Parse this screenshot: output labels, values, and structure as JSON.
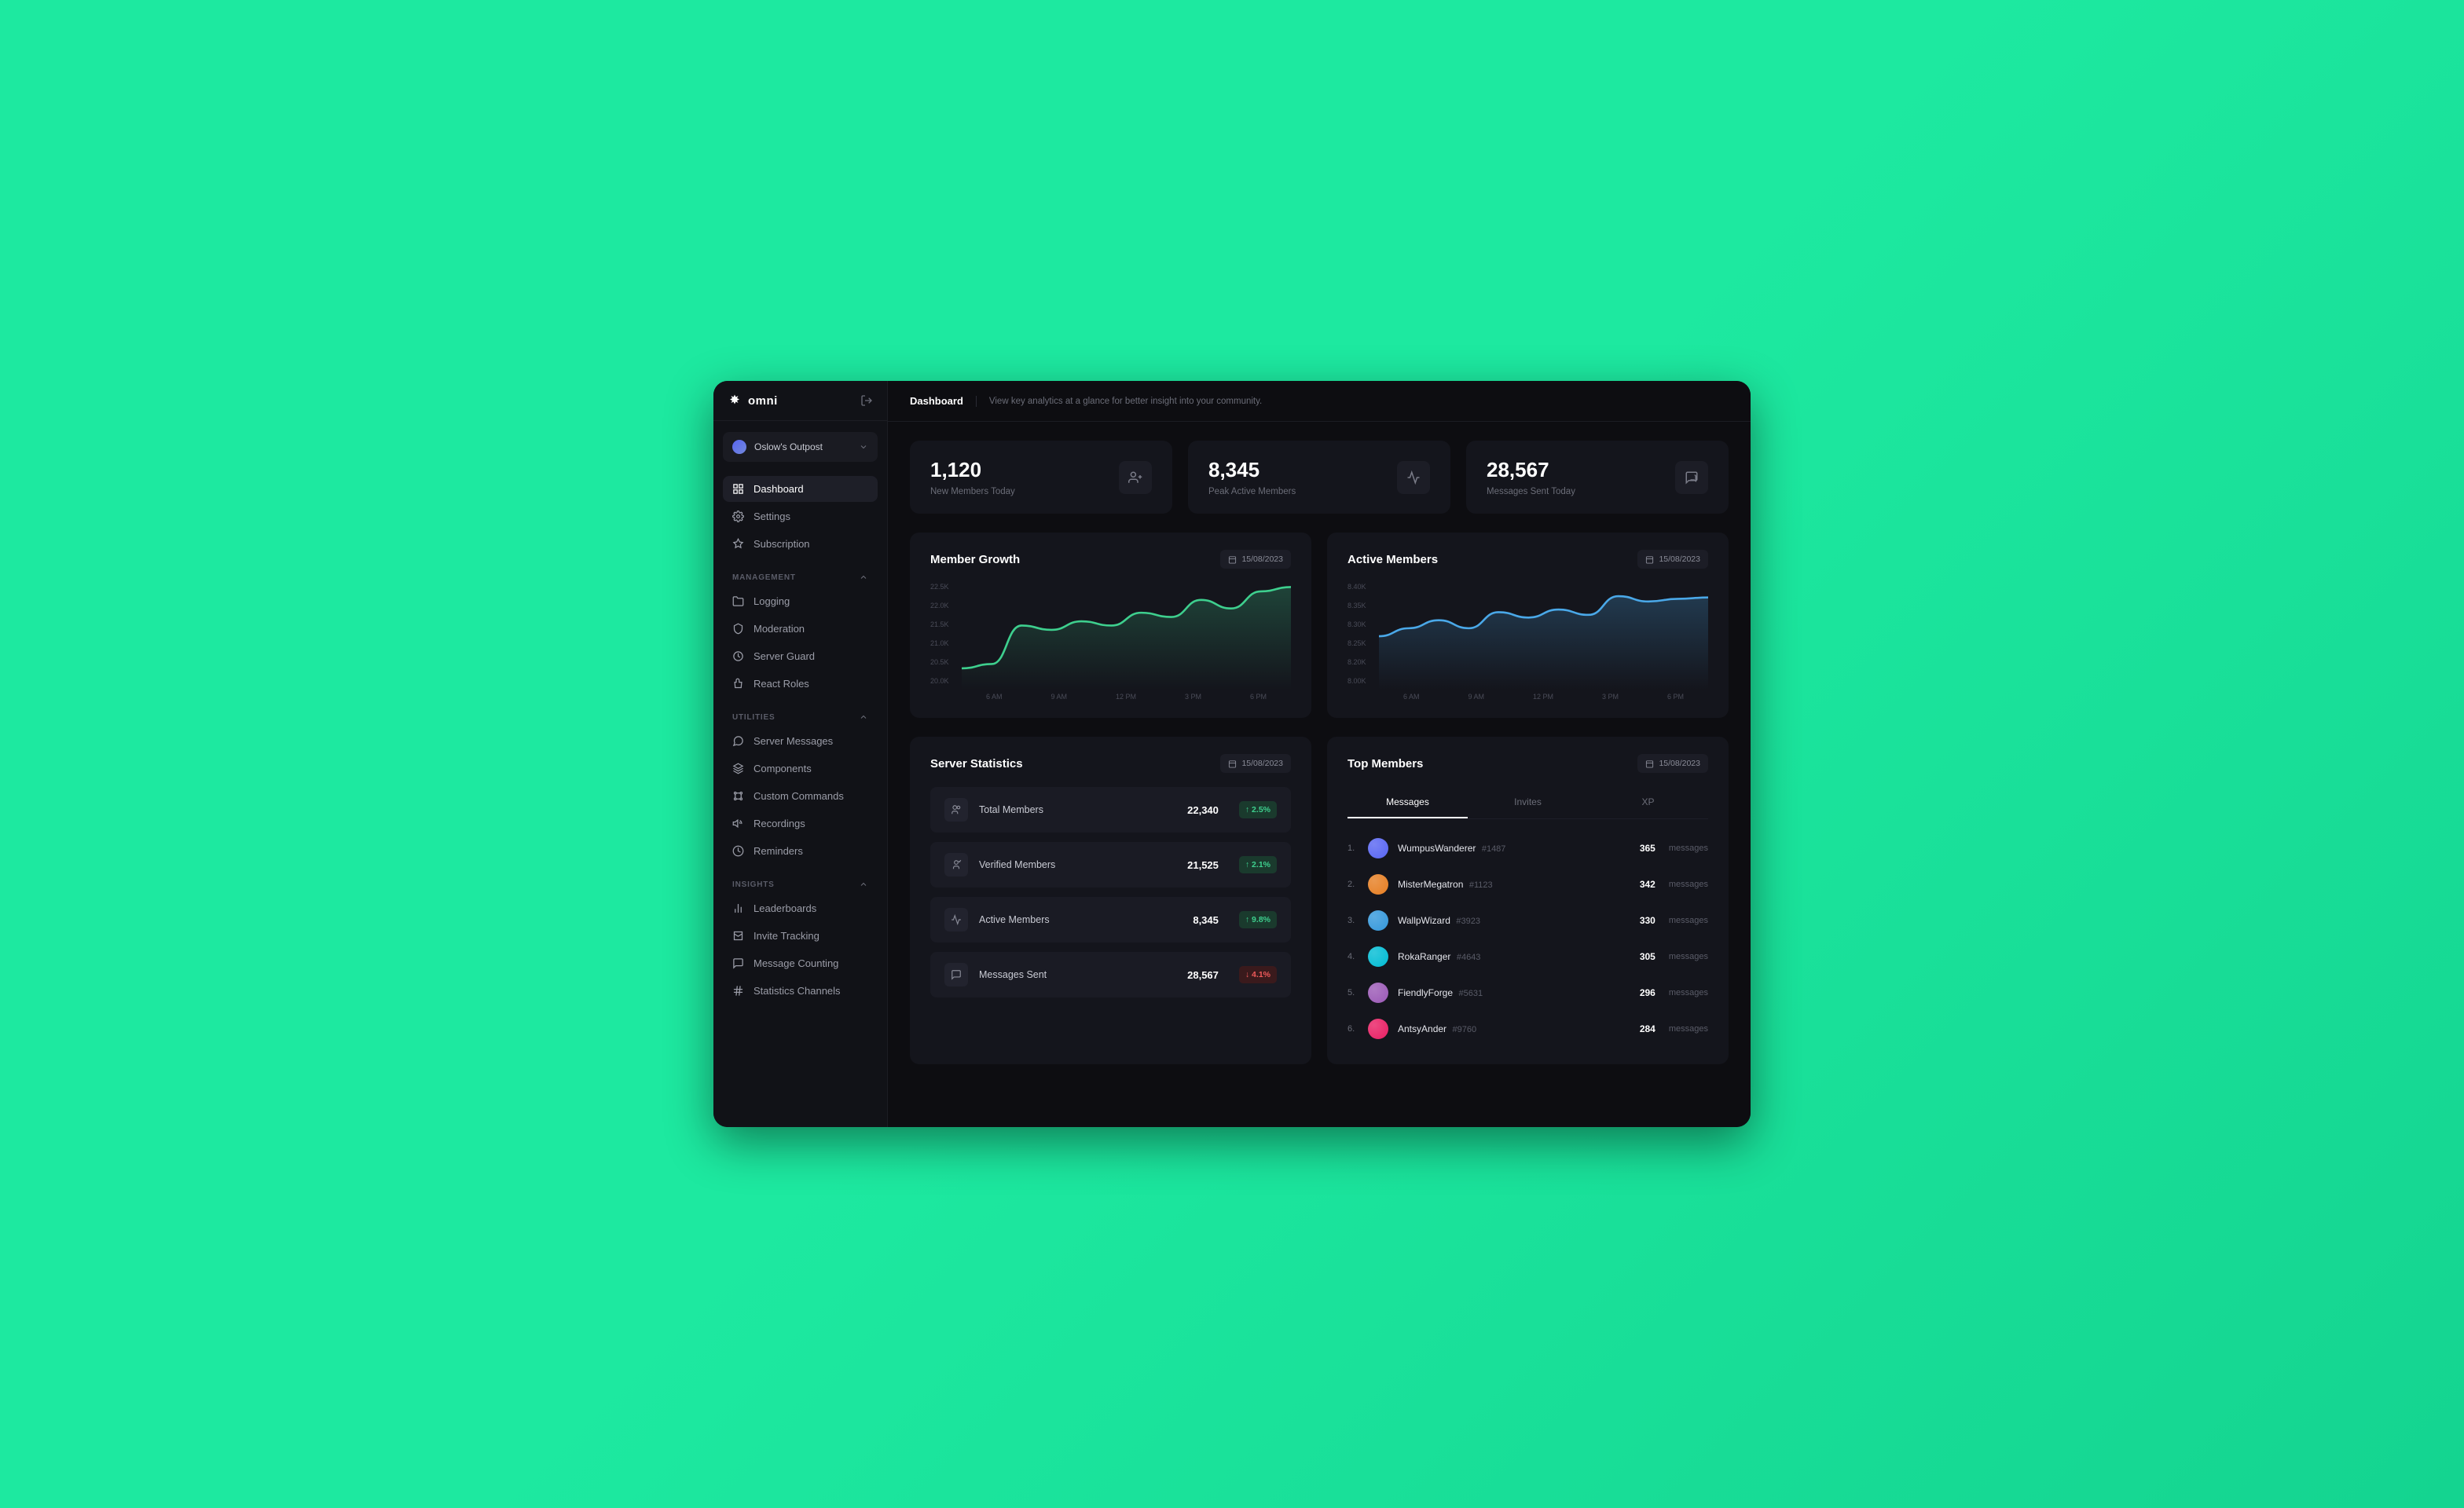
{
  "brand": {
    "name": "omni"
  },
  "server": {
    "name": "Oslow's Outpost"
  },
  "nav": {
    "top": [
      {
        "label": "Dashboard",
        "active": true
      },
      {
        "label": "Settings"
      },
      {
        "label": "Subscription"
      }
    ],
    "sections": [
      {
        "title": "MANAGEMENT",
        "items": [
          "Logging",
          "Moderation",
          "Server Guard",
          "React Roles"
        ]
      },
      {
        "title": "UTILITIES",
        "items": [
          "Server Messages",
          "Components",
          "Custom Commands",
          "Recordings",
          "Reminders"
        ]
      },
      {
        "title": "INSIGHTS",
        "items": [
          "Leaderboards",
          "Invite Tracking",
          "Message Counting",
          "Statistics Channels"
        ]
      }
    ]
  },
  "header": {
    "title": "Dashboard",
    "subtitle": "View key analytics at a glance for better insight into your community."
  },
  "cards": [
    {
      "value": "1,120",
      "label": "New Members Today"
    },
    {
      "value": "8,345",
      "label": "Peak Active Members"
    },
    {
      "value": "28,567",
      "label": "Messages Sent Today"
    }
  ],
  "charts": {
    "growth": {
      "title": "Member Growth",
      "date": "15/08/2023"
    },
    "active": {
      "title": "Active Members",
      "date": "15/08/2023"
    }
  },
  "chart_data": [
    {
      "type": "line",
      "title": "Member Growth",
      "x": [
        "6 AM",
        "9 AM",
        "12 PM",
        "3 PM",
        "6 PM"
      ],
      "y_ticks": [
        "22.5K",
        "22.0K",
        "21.5K",
        "21.0K",
        "20.5K",
        "20.0K"
      ],
      "ylim": [
        20000,
        22500
      ],
      "series": [
        {
          "name": "members",
          "color": "#3ecf8e",
          "values": [
            20500,
            20600,
            21500,
            21400,
            21600,
            21500,
            21800,
            21700,
            22100,
            21900,
            22300,
            22400
          ]
        }
      ]
    },
    {
      "type": "line",
      "title": "Active Members",
      "x": [
        "6 AM",
        "9 AM",
        "12 PM",
        "3 PM",
        "6 PM"
      ],
      "y_ticks": [
        "8.40K",
        "8.35K",
        "8.30K",
        "8.25K",
        "8.20K",
        "8.00K"
      ],
      "ylim": [
        8000,
        8400
      ],
      "series": [
        {
          "name": "active",
          "color": "#4aa8e8",
          "values": [
            8200,
            8230,
            8260,
            8230,
            8290,
            8270,
            8300,
            8280,
            8350,
            8330,
            8340,
            8345
          ]
        }
      ]
    }
  ],
  "serverStats": {
    "title": "Server Statistics",
    "date": "15/08/2023",
    "rows": [
      {
        "label": "Total Members",
        "value": "22,340",
        "delta": "↑ 2.5%",
        "dir": "up"
      },
      {
        "label": "Verified Members",
        "value": "21,525",
        "delta": "↑ 2.1%",
        "dir": "up"
      },
      {
        "label": "Active Members",
        "value": "8,345",
        "delta": "↑ 9.8%",
        "dir": "up"
      },
      {
        "label": "Messages Sent",
        "value": "28,567",
        "delta": "↓ 4.1%",
        "dir": "down"
      }
    ]
  },
  "topMembers": {
    "title": "Top Members",
    "date": "15/08/2023",
    "tabs": [
      "Messages",
      "Invites",
      "XP"
    ],
    "activeTab": 0,
    "unit": "messages",
    "list": [
      {
        "name": "WumpusWanderer",
        "tag": "#1487",
        "count": "365",
        "color": "#5865f2"
      },
      {
        "name": "MisterMegatron",
        "tag": "#1123",
        "count": "342",
        "color": "#e67e22"
      },
      {
        "name": "WallpWizard",
        "tag": "#3923",
        "count": "330",
        "color": "#3498db"
      },
      {
        "name": "RokaRanger",
        "tag": "#4643",
        "count": "305",
        "color": "#00bcd4"
      },
      {
        "name": "FiendlyForge",
        "tag": "#5631",
        "count": "296",
        "color": "#9b59b6"
      },
      {
        "name": "AntsyAnder",
        "tag": "#9760",
        "count": "284",
        "color": "#e91e63"
      }
    ]
  }
}
